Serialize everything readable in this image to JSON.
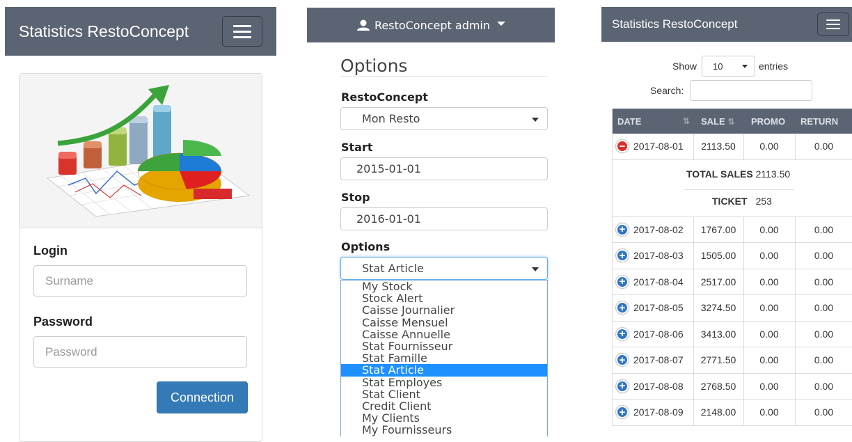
{
  "login_panel": {
    "brand": "Statistics RestoConcept",
    "login_label": "Login",
    "surname_placeholder": "Surname",
    "password_label": "Password",
    "password_placeholder": "Password",
    "connect_button": "Connection"
  },
  "options_panel": {
    "user_menu": "RestoConcept admin",
    "title": "Options",
    "resto_label": "RestoConcept",
    "resto_value": "Mon Resto",
    "start_label": "Start",
    "start_value": "2015-01-01",
    "stop_label": "Stop",
    "stop_value": "2016-01-01",
    "options_label": "Options",
    "options_value": "Stat Article",
    "dropdown_options": [
      "My Stock",
      "Stock Alert",
      "Caisse Journalier",
      "Caisse Mensuel",
      "Caisse Annuelle",
      "Stat Fournisseur",
      "Stat Famille",
      "Stat Article",
      "Stat Employes",
      "Stat Client",
      "Credit Client",
      "My Clients",
      "My Fournisseurs"
    ],
    "selected_option": "Stat Article"
  },
  "stats_panel": {
    "brand": "Statistics RestoConcept",
    "show_label": "Show",
    "entries_value": "10",
    "entries_label": "entries",
    "search_label": "Search:",
    "columns": [
      "DATE",
      "SALE",
      "PROMO",
      "RETURN"
    ],
    "rows": [
      {
        "date": "2017-08-01",
        "sale": "2113.50",
        "promo": "0.00",
        "return": "0.00",
        "expanded": true
      },
      {
        "date": "2017-08-02",
        "sale": "1767.00",
        "promo": "0.00",
        "return": "0.00"
      },
      {
        "date": "2017-08-03",
        "sale": "1505.00",
        "promo": "0.00",
        "return": "0.00"
      },
      {
        "date": "2017-08-04",
        "sale": "2517.00",
        "promo": "0.00",
        "return": "0.00"
      },
      {
        "date": "2017-08-05",
        "sale": "3274.50",
        "promo": "0.00",
        "return": "0.00"
      },
      {
        "date": "2017-08-06",
        "sale": "3413.00",
        "promo": "0.00",
        "return": "0.00"
      },
      {
        "date": "2017-08-07",
        "sale": "2771.50",
        "promo": "0.00",
        "return": "0.00"
      },
      {
        "date": "2017-08-08",
        "sale": "2768.50",
        "promo": "0.00",
        "return": "0.00"
      },
      {
        "date": "2017-08-09",
        "sale": "2148.00",
        "promo": "0.00",
        "return": "0.00"
      }
    ],
    "detail": {
      "total_sales_label": "TOTAL SALES",
      "total_sales_value": "2113.50",
      "ticket_label": "TICKET",
      "ticket_value": "253"
    }
  },
  "colors": {
    "navbar": "#5b6473",
    "primary": "#337ab7",
    "selected": "#1e90ff",
    "minus": "#d9312b",
    "plus": "#3276c3"
  }
}
